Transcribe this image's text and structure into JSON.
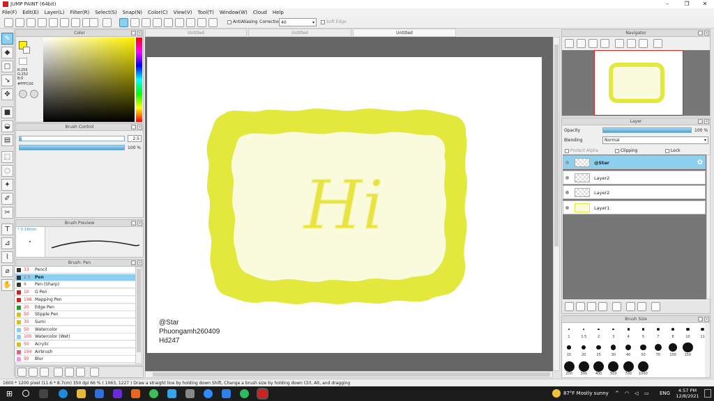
{
  "app": {
    "title": "JUMP PAINT (64bit)"
  },
  "menu": [
    "File(F)",
    "Edit(E)",
    "Layer(L)",
    "Filter(R)",
    "Select(S)",
    "Snap(N)",
    "Color(C)",
    "View(V)",
    "Tool(T)",
    "Window(W)",
    "Cloud",
    "Help"
  ],
  "toolbar": {
    "antialiasing_label": "AntiAliasing",
    "correction_label": "Correction",
    "correction_value": "40",
    "soft_edge_label": "Soft Edge"
  },
  "color_panel": {
    "title": "Color",
    "r": "R:255",
    "g": "G:252",
    "b": "B:0",
    "hex": "#FFFC00",
    "primary_color": "#fff000"
  },
  "brush_control": {
    "title": "Brush Control",
    "size": "2.5",
    "opacity": "100 %"
  },
  "brush_preview": {
    "title": "Brush Preview",
    "size_label": "* 0.18mm"
  },
  "brush_list": {
    "title": "Brush: Pen",
    "items": [
      {
        "size": "33",
        "name": "Pencil",
        "color": "#333333"
      },
      {
        "size": "2.5",
        "name": "Pen",
        "color": "#333333",
        "selected": true
      },
      {
        "size": "8",
        "name": "Pen (Sharp)",
        "color": "#333333"
      },
      {
        "size": "10",
        "name": "G Pen",
        "color": "#cc2222"
      },
      {
        "size": "198",
        "name": "Mapping Pen",
        "color": "#cc2222"
      },
      {
        "size": "20",
        "name": "Edge Pen",
        "color": "#229922"
      },
      {
        "size": "50",
        "name": "Stipple Pen",
        "color": "#ddbb22"
      },
      {
        "size": "30",
        "name": "Sumi",
        "color": "#ddbb22"
      },
      {
        "size": "50",
        "name": "Watercolor",
        "color": "#88ccee"
      },
      {
        "size": "100",
        "name": "Watercolor (Wet)",
        "color": "#88ccee"
      },
      {
        "size": "50",
        "name": "Acrylic",
        "color": "#ddbb22"
      },
      {
        "size": "194",
        "name": "Airbrush",
        "color": "#dd6688"
      },
      {
        "size": "50",
        "name": "Blur",
        "color": "#ee99dd"
      }
    ]
  },
  "tabs": [
    "Untitled",
    "Untitled",
    "Untitled"
  ],
  "artwork": {
    "greeting": "Hi",
    "credit_lines": [
      "@Star",
      "Phuongamh260409",
      "Hd247"
    ],
    "frame_color": "#e2e83c",
    "inner_color": "#fafbdd"
  },
  "navigator": {
    "title": "Navigator"
  },
  "layer_panel": {
    "title": "Layer",
    "opacity_label": "Opacity",
    "opacity_value": "100 %",
    "blending_label": "Blending",
    "blending_value": "Normal",
    "protect_alpha": "Protect Alpha",
    "clipping": "Clipping",
    "lock": "Lock",
    "layers": [
      {
        "name": "@Star",
        "selected": true
      },
      {
        "name": "Layer2"
      },
      {
        "name": "Layer2"
      },
      {
        "name": "Layer1"
      }
    ]
  },
  "brush_size": {
    "title": "Brush Size",
    "rows": [
      [
        "1",
        "1.5",
        "2",
        "3",
        "4",
        "5",
        "7",
        "8",
        "10",
        "11"
      ],
      [
        "15",
        "20",
        "25",
        "30",
        "40",
        "50",
        "70",
        "100",
        "150"
      ],
      [
        "200",
        "300",
        "400",
        "500",
        "700",
        "1000"
      ]
    ]
  },
  "status": {
    "text": "1600 * 1200 pixel   (11.6 * 8.7cm)   350 dpi   66 %   ( 1063, 1227 )   Draw a straight line by holding down Shift, Change a brush size by holding down Ctrl, Alt, and dragging"
  },
  "taskbar": {
    "weather": "87°F  Mostly sunny",
    "lang": "ENG",
    "time": "4:57 PM",
    "date": "12/8/2021"
  }
}
